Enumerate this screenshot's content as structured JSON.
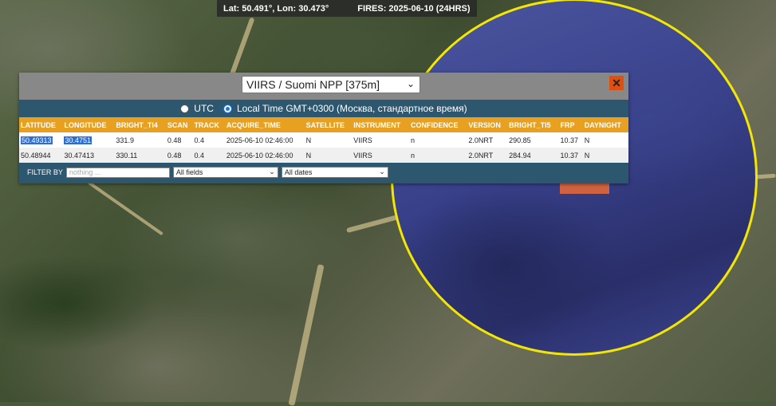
{
  "status": {
    "coords": "Lat: 50.491°, Lon: 30.473°",
    "fires": "FIRES: 2025-06-10 (24HRS)"
  },
  "panel": {
    "sensor_select": "VIIRS / Suomi NPP [375m]",
    "close_label": "✕",
    "time_options": [
      {
        "label": "UTC",
        "selected": false
      },
      {
        "label": "Local Time GMT+0300 (Москва, стандартное время)",
        "selected": true
      }
    ],
    "columns": [
      "LATITUDE",
      "LONGITUDE",
      "BRIGHT_TI4",
      "SCAN",
      "TRACK",
      "ACQUIRE_TIME",
      "SATELLITE",
      "INSTRUMENT",
      "CONFIDENCE",
      "VERSION",
      "BRIGHT_TI5",
      "FRP",
      "DAYNIGHT"
    ],
    "rows": [
      [
        "50.49313",
        "30.4751",
        "331.9",
        "0.48",
        "0.4",
        "2025-06-10 02:46:00",
        "N",
        "VIIRS",
        "n",
        "2.0NRT",
        "290.85",
        "10.37",
        "N"
      ],
      [
        "50.48944",
        "30.47413",
        "330.11",
        "0.48",
        "0.4",
        "2025-06-10 02:46:00",
        "N",
        "VIIRS",
        "n",
        "2.0NRT",
        "284.94",
        "10.37",
        "N"
      ]
    ],
    "filter": {
      "label": "FILTER BY",
      "placeholder": "nothing ...",
      "field_select": "All fields",
      "date_select": "All dates"
    }
  },
  "colors": {
    "aoi_circle": "#f3e600",
    "header_row": "#e8a020",
    "panel_bg": "#2d566f",
    "close_button": "#e04e10"
  }
}
